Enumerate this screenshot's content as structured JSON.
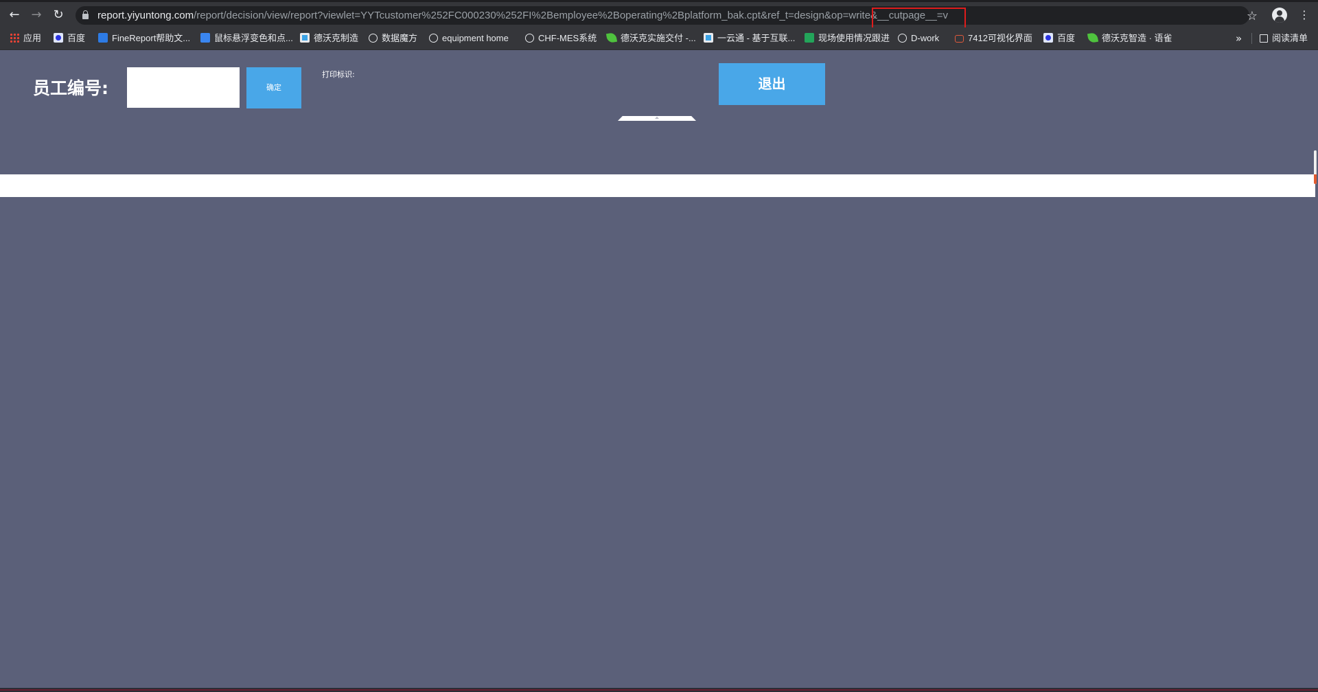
{
  "browser": {
    "url": {
      "host": "report.yiyuntong.com",
      "path": "/report/decision/view/report?viewlet=YYTcustomer%252FC000230%252FI%2Bemployee%2Boperating%2Bplatform_bak.cpt&ref_t=design&op=write&__cutpage__=v"
    },
    "bookmarks": [
      {
        "label": "应用",
        "icon": "apps-icon"
      },
      {
        "label": "百度",
        "icon": "baidu-icon"
      },
      {
        "label": "FineReport帮助文...",
        "icon": "finereport-icon"
      },
      {
        "label": "鼠标悬浮变色和点...",
        "icon": "finereport-icon"
      },
      {
        "label": "德沃克制造",
        "icon": "image-icon"
      },
      {
        "label": "数据魔方",
        "icon": "globe-icon"
      },
      {
        "label": "equipment home",
        "icon": "globe-icon"
      },
      {
        "label": "CHF-MES系统",
        "icon": "globe-icon"
      },
      {
        "label": "德沃克实施交付 -...",
        "icon": "leaf-icon"
      },
      {
        "label": "一云通 - 基于互联...",
        "icon": "image-icon"
      },
      {
        "label": "现场使用情况跟进",
        "icon": "sheet-icon"
      },
      {
        "label": "D-work",
        "icon": "globe-icon"
      },
      {
        "label": "7412可视化界面",
        "icon": "cloud-icon"
      },
      {
        "label": "百度",
        "icon": "baidu-icon"
      },
      {
        "label": "德沃克智造 · 语雀",
        "icon": "leaf-icon"
      }
    ],
    "more_label": "»",
    "reading_list_label": "阅读清单"
  },
  "page": {
    "employee_label": "员工编号:",
    "employee_input_value": "",
    "confirm_label": "确定",
    "print_label": "打印标识:",
    "exit_label": "退出"
  },
  "colors": {
    "page_background": "#5b6079",
    "button_blue": "#49a7e8",
    "highlight_box": "#e01c1c"
  }
}
